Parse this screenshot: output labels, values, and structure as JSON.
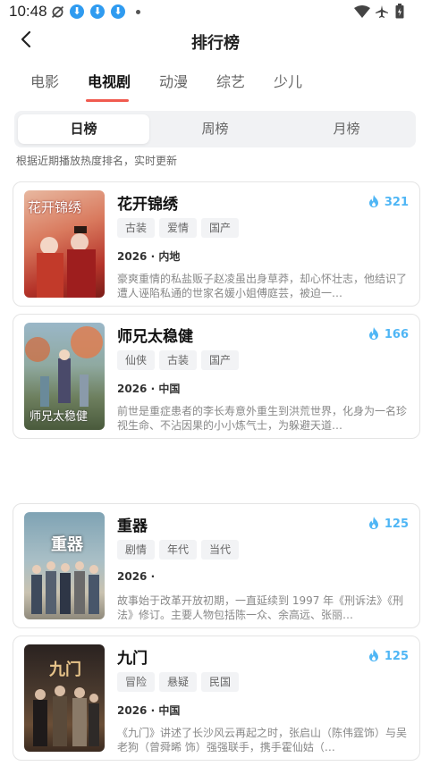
{
  "status": {
    "time": "10:48"
  },
  "header": {
    "title": "排行榜"
  },
  "tabs": [
    {
      "label": "电影"
    },
    {
      "label": "电视剧",
      "active": true
    },
    {
      "label": "动漫"
    },
    {
      "label": "综艺"
    },
    {
      "label": "少儿"
    }
  ],
  "segments": [
    {
      "label": "日榜",
      "active": true
    },
    {
      "label": "周榜"
    },
    {
      "label": "月榜"
    }
  ],
  "hint": "根据近期播放热度排名，实时更新",
  "items": [
    {
      "title": "花开锦绣",
      "heat": "321",
      "tags": [
        "古装",
        "爱情",
        "国产"
      ],
      "meta": "2026 · 内地",
      "desc": "豪爽重情的私盐贩子赵凌虽出身草莽，却心怀壮志，他结识了遭人诬陷私通的世家名媛小姐傅庭芸，被迫一…",
      "poster_text": "花开锦绣"
    },
    {
      "title": "师兄太稳健",
      "heat": "166",
      "tags": [
        "仙侠",
        "古装",
        "国产"
      ],
      "meta": "2026 · 中国",
      "desc": "前世是重症患者的李长寿意外重生到洪荒世界，化身为一名珍视生命、不沾因果的小小炼气士，为躲避天道…",
      "poster_text": "师兄太稳健"
    },
    {
      "title": "重器",
      "heat": "125",
      "tags": [
        "剧情",
        "年代",
        "当代"
      ],
      "meta": "2026 ·",
      "desc": "故事始于改革开放初期，一直延续到 1997 年《刑诉法》《刑法》修订。主要人物包括陈一众、余高远、张丽…",
      "poster_text": "重器"
    },
    {
      "title": "九门",
      "heat": "125",
      "tags": [
        "冒险",
        "悬疑",
        "民国"
      ],
      "meta": "2026 · 中国",
      "desc": "《九门》讲述了长沙风云再起之时，张启山（陈伟霆饰）与吴老狗（曾舜晞 饰）强强联手，携手霍仙姑（…",
      "poster_text": "九门"
    }
  ],
  "colors": {
    "accent": "#f05a4f",
    "heat": "#4fb6f5"
  }
}
